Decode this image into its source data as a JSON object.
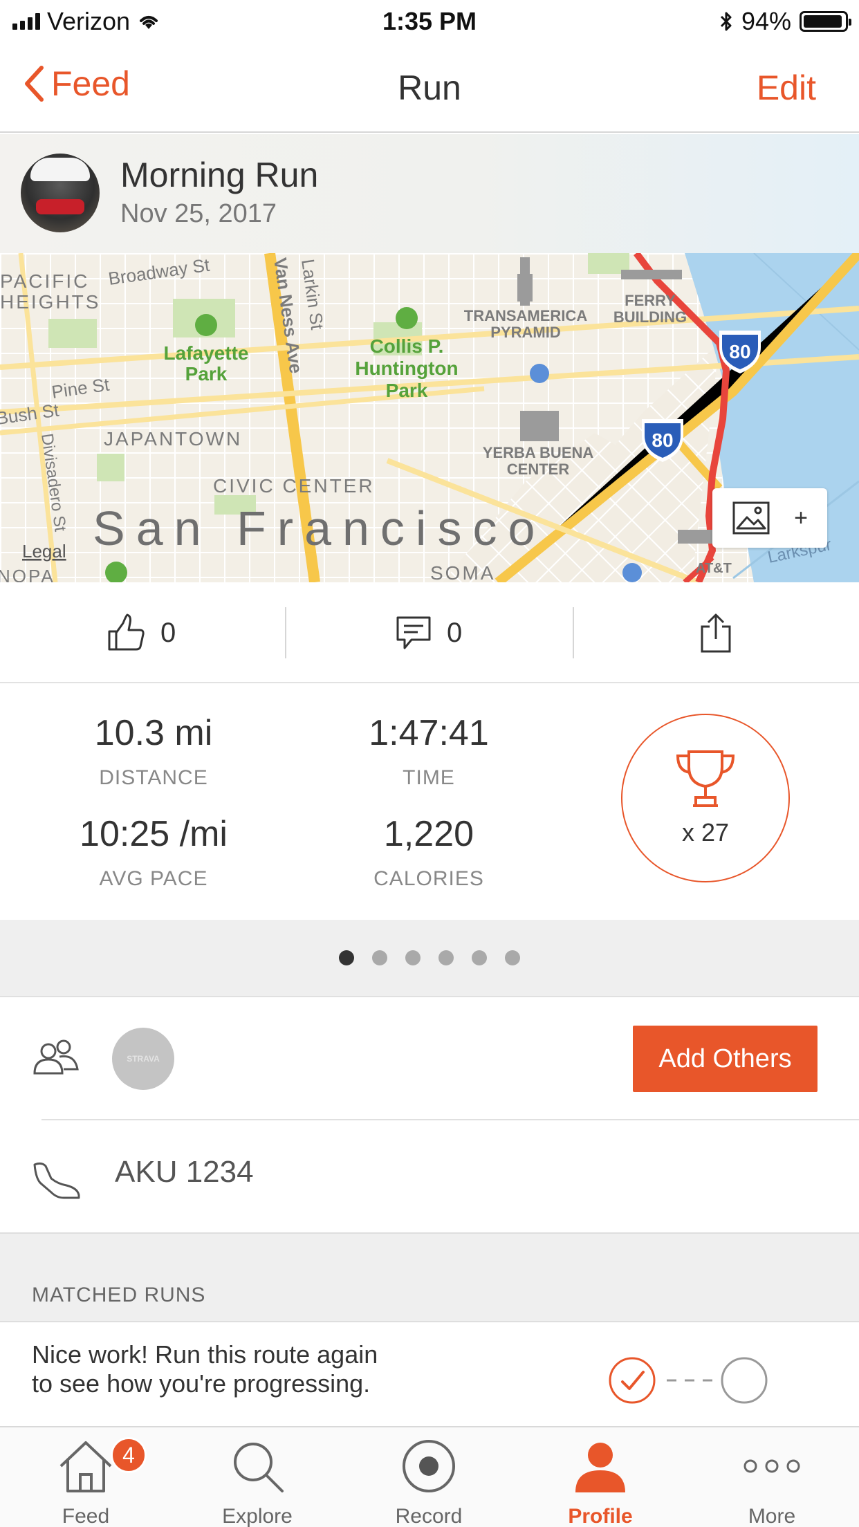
{
  "status_bar": {
    "carrier": "Verizon",
    "time": "1:35 PM",
    "battery": "94%",
    "battery_level": 0.94
  },
  "nav": {
    "back_label": "Feed",
    "title": "Run",
    "edit_label": "Edit"
  },
  "activity": {
    "title": "Morning Run",
    "date": "Nov 25, 2017"
  },
  "map": {
    "city": "San Francisco",
    "legal": "Legal",
    "labels": [
      "PACIFIC",
      "HEIGHTS",
      "Broadway St",
      "Van Ness Ave",
      "Larkin St",
      "TRANSAMERICA",
      "PYRAMID",
      "FERRY",
      "BUILDING",
      "Lafayette",
      "Park",
      "Collis P.",
      "Huntington",
      "Park",
      "Pine St",
      "Bush St",
      "JAPANTOWN",
      "Divisadero St",
      "YERBA BUENA",
      "CENTER",
      "CIVIC CENTER",
      "SOMA",
      "NOPA",
      "AT&T",
      "Larkspur"
    ],
    "highway": "80",
    "photo_add": "+"
  },
  "social": {
    "kudos_count": "0",
    "comments_count": "0"
  },
  "stats": {
    "distance_value": "10.3 mi",
    "distance_label": "DISTANCE",
    "time_value": "1:47:41",
    "time_label": "TIME",
    "pace_value": "10:25 /mi",
    "pace_label": "AVG PACE",
    "calories_value": "1,220",
    "calories_label": "CALORIES",
    "achievements": "x 27"
  },
  "pager": {
    "pages": 6,
    "current": 0
  },
  "athletes": {
    "avatar_text": "STRAVA",
    "add_button": "Add Others"
  },
  "gear": {
    "name": "AKU 1234"
  },
  "matched_runs": {
    "header": "MATCHED RUNS",
    "message": "Nice work! Run this route again to see how you're progressing."
  },
  "tabbar": {
    "tabs": [
      {
        "label": "Feed",
        "icon": "home-icon"
      },
      {
        "label": "Explore",
        "icon": "search-icon"
      },
      {
        "label": "Record",
        "icon": "record-icon"
      },
      {
        "label": "Profile",
        "icon": "profile-icon"
      },
      {
        "label": "More",
        "icon": "more-icon"
      }
    ],
    "feed_badge": "4",
    "active": "Profile"
  },
  "colors": {
    "accent": "#e8562a",
    "map_land": "#f4efe4",
    "map_water": "#abd3ee",
    "map_highway": "#f7c74a",
    "map_park": "#cfe5b5",
    "route": "#e8453c"
  }
}
